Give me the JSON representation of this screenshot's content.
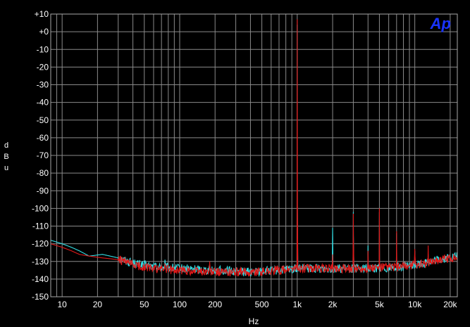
{
  "chart_data": {
    "type": "line",
    "xlabel": "Hz",
    "ylabel": "dBu",
    "xscale": "log",
    "xlim": [
      8,
      23000
    ],
    "ylim": [
      -150,
      10
    ],
    "grid": true,
    "legend": "none",
    "logo": "Ap",
    "background": "#000000",
    "grid_color": "#8a8a8a",
    "logo_color": "#1a34ff",
    "x_ticks": [
      {
        "value": 10,
        "label": "10"
      },
      {
        "value": 20,
        "label": "20"
      },
      {
        "value": 50,
        "label": "50"
      },
      {
        "value": 100,
        "label": "100"
      },
      {
        "value": 200,
        "label": "200"
      },
      {
        "value": 500,
        "label": "500"
      },
      {
        "value": 1000,
        "label": "1k"
      },
      {
        "value": 2000,
        "label": "2k"
      },
      {
        "value": 5000,
        "label": "5k"
      },
      {
        "value": 10000,
        "label": "10k"
      },
      {
        "value": 20000,
        "label": "20k"
      }
    ],
    "y_ticks": [
      {
        "value": 10,
        "label": "+10"
      },
      {
        "value": 0,
        "label": "+0"
      },
      {
        "value": -10,
        "label": "-10"
      },
      {
        "value": -20,
        "label": "-20"
      },
      {
        "value": -30,
        "label": "-30"
      },
      {
        "value": -40,
        "label": "-40"
      },
      {
        "value": -50,
        "label": "-50"
      },
      {
        "value": -60,
        "label": "-60"
      },
      {
        "value": -70,
        "label": "-70"
      },
      {
        "value": -80,
        "label": "-80"
      },
      {
        "value": -90,
        "label": "-90"
      },
      {
        "value": -100,
        "label": "-100"
      },
      {
        "value": -110,
        "label": "-110"
      },
      {
        "value": -120,
        "label": "-120"
      },
      {
        "value": -130,
        "label": "-130"
      },
      {
        "value": -140,
        "label": "-140"
      },
      {
        "value": -150,
        "label": "-150"
      }
    ],
    "series": [
      {
        "color": "#33e0e6",
        "floor": [
          [
            8,
            -118
          ],
          [
            10,
            -120
          ],
          [
            12,
            -122
          ],
          [
            14,
            -124
          ],
          [
            17,
            -127
          ],
          [
            22,
            -126
          ],
          [
            30,
            -128
          ],
          [
            40,
            -131
          ],
          [
            60,
            -133
          ],
          [
            100,
            -134
          ],
          [
            200,
            -135
          ],
          [
            400,
            -136
          ],
          [
            700,
            -135
          ],
          [
            1000,
            -134
          ],
          [
            2000,
            -134
          ],
          [
            4000,
            -134
          ],
          [
            8000,
            -133
          ],
          [
            12000,
            -131
          ],
          [
            16000,
            -129
          ],
          [
            20000,
            -128
          ],
          [
            23000,
            -127
          ]
        ],
        "peaks": [
          [
            75,
            -129
          ],
          [
            180,
            -132
          ],
          [
            1000,
            4
          ],
          [
            2000,
            -111
          ],
          [
            3000,
            -102
          ],
          [
            4000,
            -121
          ],
          [
            5000,
            -102
          ],
          [
            7000,
            -114
          ],
          [
            10000,
            -124
          ],
          [
            13000,
            -126
          ]
        ]
      },
      {
        "color": "#e01818",
        "floor": [
          [
            8,
            -120
          ],
          [
            10,
            -122
          ],
          [
            12,
            -124
          ],
          [
            14,
            -126
          ],
          [
            17,
            -127
          ],
          [
            22,
            -128
          ],
          [
            30,
            -129
          ],
          [
            40,
            -132
          ],
          [
            60,
            -134
          ],
          [
            100,
            -135
          ],
          [
            200,
            -136
          ],
          [
            400,
            -136
          ],
          [
            700,
            -135
          ],
          [
            1000,
            -134
          ],
          [
            2000,
            -134
          ],
          [
            4000,
            -134
          ],
          [
            8000,
            -133
          ],
          [
            12000,
            -131
          ],
          [
            16000,
            -129
          ],
          [
            20000,
            -128
          ],
          [
            23000,
            -128
          ]
        ],
        "peaks": [
          [
            75,
            -131
          ],
          [
            180,
            -130
          ],
          [
            1000,
            7
          ],
          [
            2000,
            -126
          ],
          [
            3000,
            -103
          ],
          [
            4000,
            -124
          ],
          [
            5000,
            -100
          ],
          [
            7000,
            -113
          ],
          [
            10000,
            -123
          ],
          [
            13000,
            -121
          ]
        ]
      }
    ]
  }
}
